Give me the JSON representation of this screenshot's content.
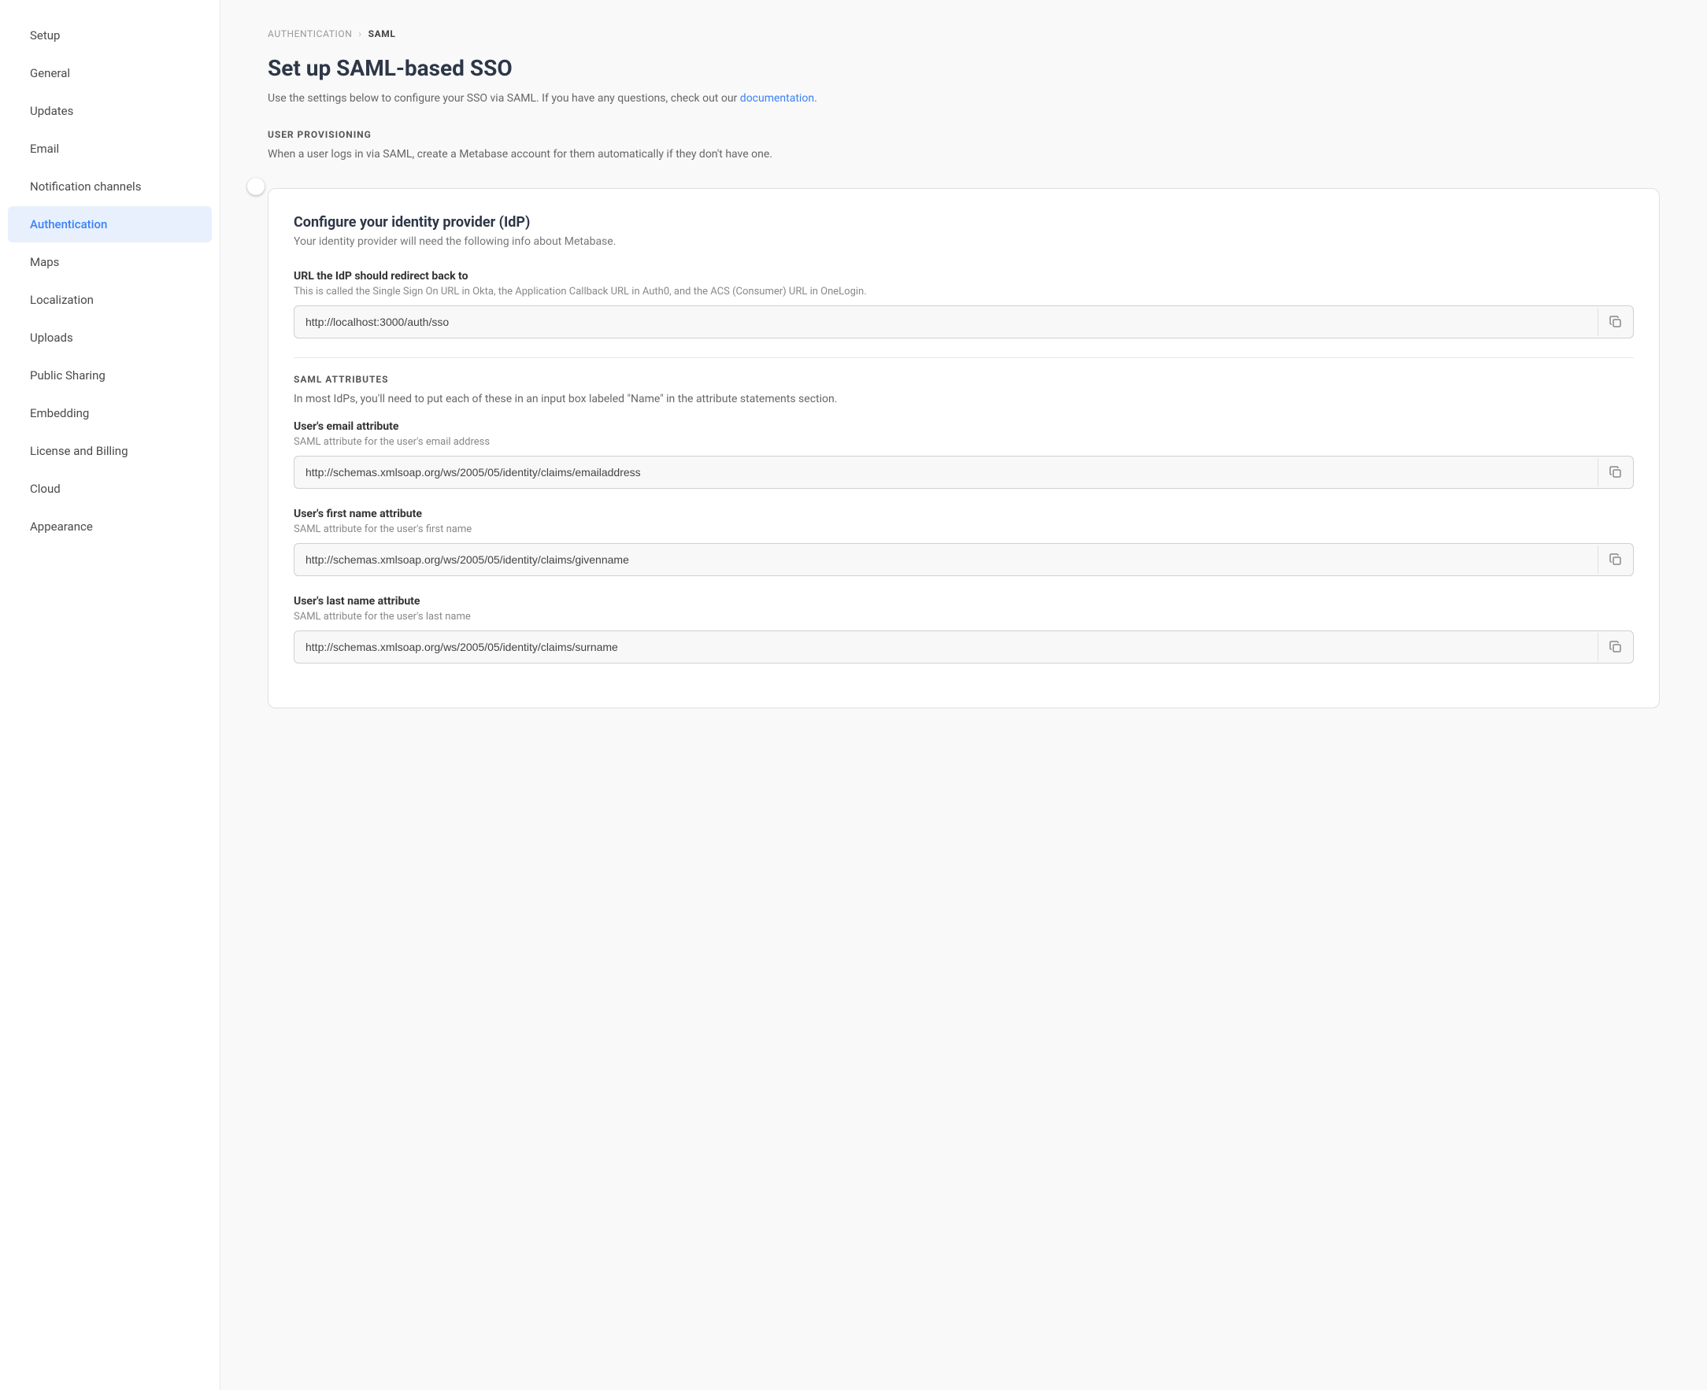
{
  "sidebar": {
    "items": [
      {
        "id": "setup",
        "label": "Setup",
        "active": false
      },
      {
        "id": "general",
        "label": "General",
        "active": false
      },
      {
        "id": "updates",
        "label": "Updates",
        "active": false
      },
      {
        "id": "email",
        "label": "Email",
        "active": false
      },
      {
        "id": "notification-channels",
        "label": "Notification channels",
        "active": false
      },
      {
        "id": "authentication",
        "label": "Authentication",
        "active": true
      },
      {
        "id": "maps",
        "label": "Maps",
        "active": false
      },
      {
        "id": "localization",
        "label": "Localization",
        "active": false
      },
      {
        "id": "uploads",
        "label": "Uploads",
        "active": false
      },
      {
        "id": "public-sharing",
        "label": "Public Sharing",
        "active": false
      },
      {
        "id": "embedding",
        "label": "Embedding",
        "active": false
      },
      {
        "id": "license-and-billing",
        "label": "License and Billing",
        "active": false
      },
      {
        "id": "cloud",
        "label": "Cloud",
        "active": false
      },
      {
        "id": "appearance",
        "label": "Appearance",
        "active": false
      }
    ]
  },
  "breadcrumb": {
    "parent": "AUTHENTICATION",
    "separator": "›",
    "current": "SAML"
  },
  "page": {
    "title": "Set up SAML-based SSO",
    "description": "Use the settings below to configure your SSO via SAML. If you have any questions, check out our",
    "description_link_text": "documentation",
    "description_end": "."
  },
  "user_provisioning": {
    "section_title": "USER PROVISIONING",
    "description": "When a user logs in via SAML, create a Metabase account for them automatically if they don't have one.",
    "toggle_enabled": true
  },
  "idp_card": {
    "title": "Configure your identity provider (IdP)",
    "subtitle": "Your identity provider will need the following info about Metabase.",
    "url_field": {
      "label": "URL the IdP should redirect back to",
      "description": "This is called the Single Sign On URL in Okta, the Application Callback URL in Auth0, and the ACS (Consumer) URL in OneLogin.",
      "value": "http://localhost:3000/auth/sso"
    },
    "saml_attributes": {
      "section_title": "SAML attributes",
      "description": "In most IdPs, you'll need to put each of these in an input box labeled \"Name\" in the attribute statements section.",
      "email_field": {
        "label": "User's email attribute",
        "description": "SAML attribute for the user's email address",
        "value": "http://schemas.xmlsoap.org/ws/2005/05/identity/claims/emailaddress"
      },
      "firstname_field": {
        "label": "User's first name attribute",
        "description": "SAML attribute for the user's first name",
        "value": "http://schemas.xmlsoap.org/ws/2005/05/identity/claims/givenname"
      },
      "lastname_field": {
        "label": "User's last name attribute",
        "description": "SAML attribute for the user's last name",
        "value": "http://schemas.xmlsoap.org/ws/2005/05/identity/claims/surname"
      }
    }
  },
  "colors": {
    "active_nav": "#3b82f6",
    "toggle_on": "#3b82f6"
  }
}
